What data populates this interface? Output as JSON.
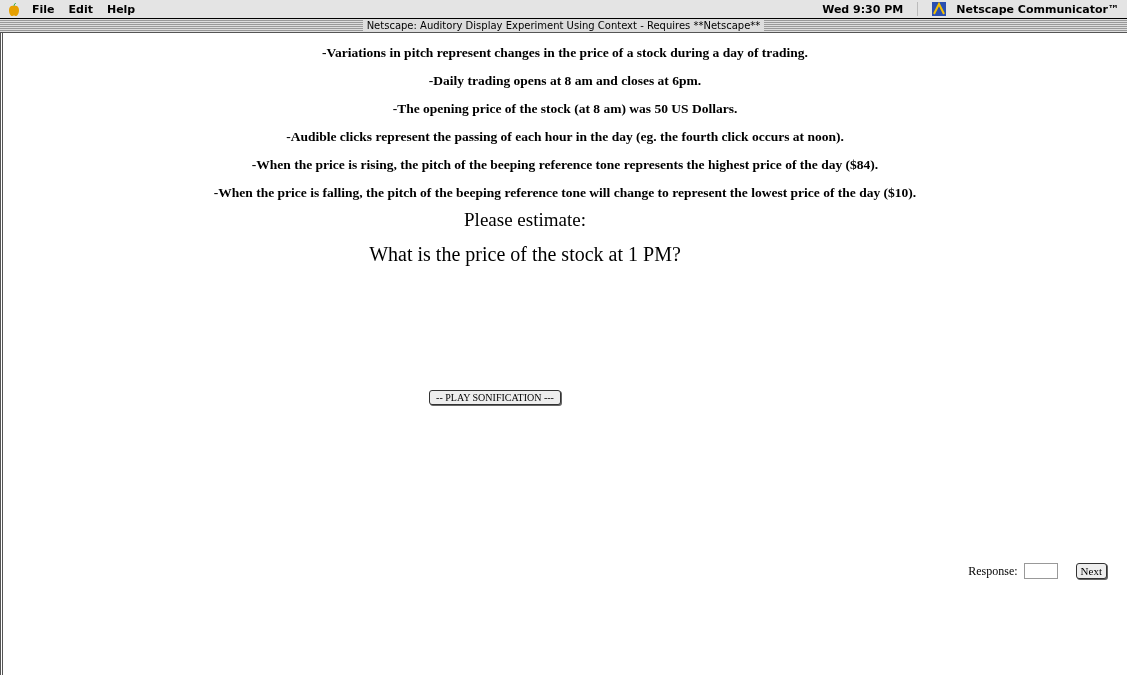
{
  "menu_bar": {
    "menus": [
      "File",
      "Edit",
      "Help"
    ],
    "clock": "Wed 9:30 PM",
    "app": "Netscape Communicator™"
  },
  "window": {
    "title": "Netscape: Auditory Display Experiment Using Context - Requires **Netscape**"
  },
  "instructions": [
    "-Variations in pitch represent changes in the price of a stock during a day of trading.",
    "-Daily trading opens at 8 am and closes at 6pm.",
    "-The opening price of the stock (at 8 am) was 50 US Dollars.",
    "-Audible clicks represent the passing of each hour in the day (eg. the fourth click occurs at noon).",
    "-When the price is rising, the pitch of the beeping reference tone represents the highest price of the day ($84).",
    "-When the price is falling, the pitch of the beeping reference tone will change to represent the lowest price of the day ($10)."
  ],
  "prompt": "Please estimate:",
  "question": "What is the price of the stock at 1 PM?",
  "play_button": "-- PLAY SONIFICATION ---",
  "response": {
    "label": "Response:",
    "button": "Next"
  }
}
